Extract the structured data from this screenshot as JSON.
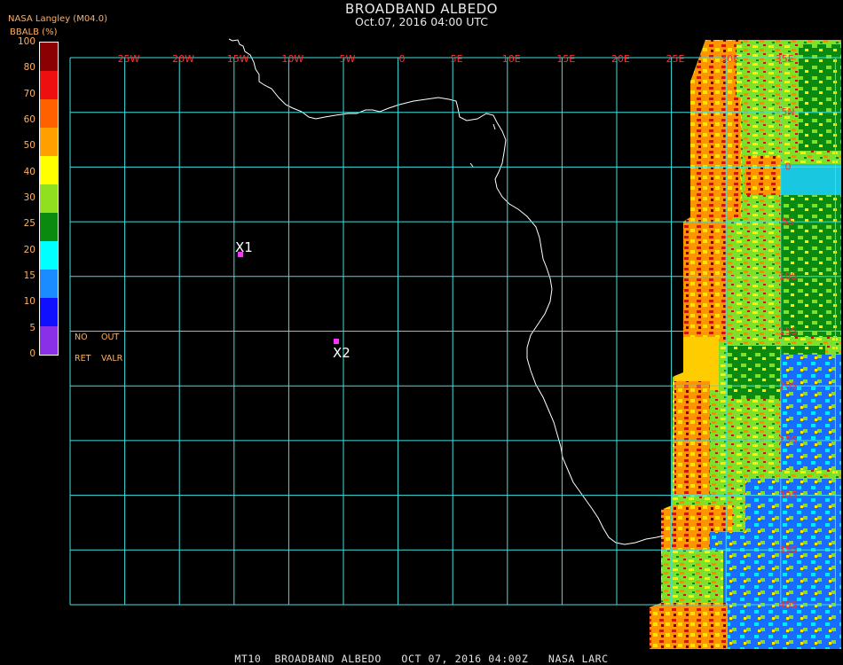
{
  "header": {
    "title": "BROADBAND ALBEDO",
    "datetime": "Oct.07, 2016 04:00 UTC",
    "producer": "NASA Langley (M04.0)"
  },
  "colorbar": {
    "units_label": "BBALB (%)",
    "ticks": [
      "100",
      "80",
      "70",
      "60",
      "50",
      "40",
      "30",
      "25",
      "20",
      "15",
      "10",
      "5",
      "0"
    ],
    "colors": [
      "#8b0000",
      "#ee1010",
      "#ff6000",
      "#ffa000",
      "#ffff00",
      "#90e020",
      "#0b8a10",
      "#00ffff",
      "#1a8cff",
      "#1010ff",
      "#8a30e8"
    ],
    "mask_labels": {
      "no": "NO",
      "out": "OUT",
      "ret": "RET",
      "valr": "VALR"
    }
  },
  "map": {
    "lon_labels": [
      "25W",
      "20W",
      "15W",
      "10W",
      "5W",
      "0",
      "5E",
      "10E",
      "15E",
      "20E",
      "25E",
      "30E",
      "35E"
    ],
    "lat_labels": [
      "5N",
      "0",
      "5S",
      "10S",
      "15S",
      "20S",
      "25S",
      "30S",
      "35S",
      "40S"
    ],
    "markers": [
      {
        "label": "X1",
        "color": "#ff30ff"
      },
      {
        "label": "X2",
        "color": "#ff30ff"
      }
    ],
    "grid_color": "#40e0e0",
    "label_color": "#ff3030"
  },
  "footer": {
    "text": "MT10  BROADBAND ALBEDO   OCT 07, 2016 04:00Z   NASA LARC"
  }
}
